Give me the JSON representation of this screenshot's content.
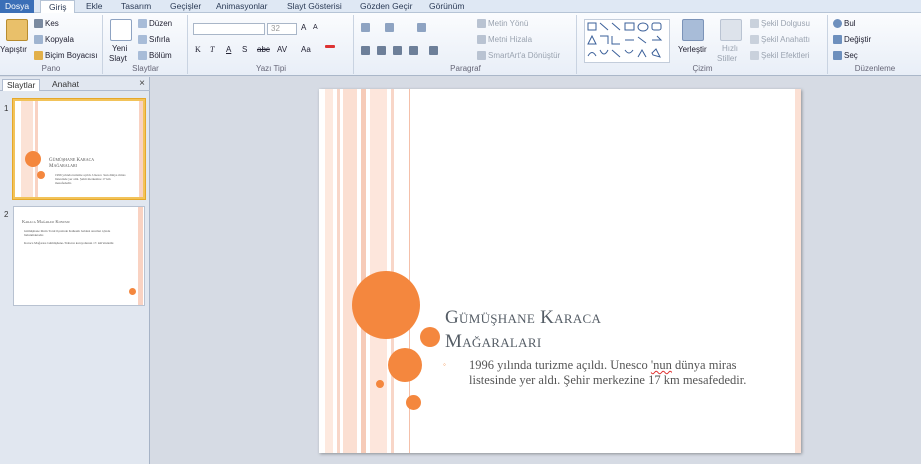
{
  "tabs": {
    "file": "Dosya",
    "home": "Giriş",
    "insert": "Ekle",
    "design": "Tasarım",
    "transitions": "Geçişler",
    "animations": "Animasyonlar",
    "slideshow": "Slayt Gösterisi",
    "review": "Gözden Geçir",
    "view": "Görünüm"
  },
  "ribbon": {
    "clipboard": {
      "paste": "Yapıştır",
      "cut": "Kes",
      "copy": "Kopyala",
      "format_painter": "Biçim Boyacısı",
      "label": "Pano"
    },
    "slides": {
      "new_slide_1": "Yeni",
      "new_slide_2": "Slayt",
      "layout": "Düzen",
      "reset": "Sıfırla",
      "section": "Bölüm",
      "label": "Slaytlar"
    },
    "font": {
      "size": "32",
      "label": "Yazı Tipi",
      "bold": "K",
      "italic": "T",
      "underline": "A",
      "strike": "S",
      "abc": "abc",
      "spacing": "AV",
      "case": "Aa",
      "grow": "A",
      "shrink": "A"
    },
    "paragraph": {
      "text_direction": "Metin Yönü",
      "align_text": "Metni Hizala",
      "smartart": "SmartArt'a Dönüştür",
      "label": "Paragraf"
    },
    "drawing": {
      "arrange": "Yerleştir",
      "quick_styles_1": "Hızlı",
      "quick_styles_2": "Stiller",
      "shape_fill": "Şekil Dolgusu",
      "shape_outline": "Şekil Anahattı",
      "shape_effects": "Şekil Efektleri",
      "label": "Çizim"
    },
    "editing": {
      "find": "Bul",
      "replace": "Değiştir",
      "select": "Seç",
      "label": "Düzenleme"
    }
  },
  "left_panel": {
    "tab_slides": "Slaytlar",
    "tab_outline": "Anahat",
    "close": "×",
    "slides": [
      {
        "number": "1",
        "title": "Gümüşhane Karaca Mağaraları",
        "body": "1996 yılında turizme açıldı. Unesco 'nun dünya miras listesinde yer aldı. Şehir merkezine 17 km mesafededir."
      },
      {
        "number": "2",
        "title": "Karaca Mağarası Konumu",
        "bullet1": "Gümüşhane ilinin Torul ilçesinde Kalkanlı beldesi sınırları içinde bulunmaktadır.",
        "bullet2": "Karaca Mağarası Gümüşhane-Trabzon karayolunun 17. km'sindedir."
      }
    ]
  },
  "slide": {
    "title_line1": "Gümüşhane Karaca",
    "title_line2": "Mağaraları",
    "bullet": "◦",
    "body_a": "1996 yılında turizme açıldı. Unesco ",
    "body_squiggle": "'nun",
    "body_b": " dünya miras listesinde yer aldı. Şehir merkezine 17 km mesafededir."
  },
  "colors": {
    "accent": "#f4873e",
    "file_tab": "#3b6fb7",
    "stripe": "#f8d6c8"
  }
}
